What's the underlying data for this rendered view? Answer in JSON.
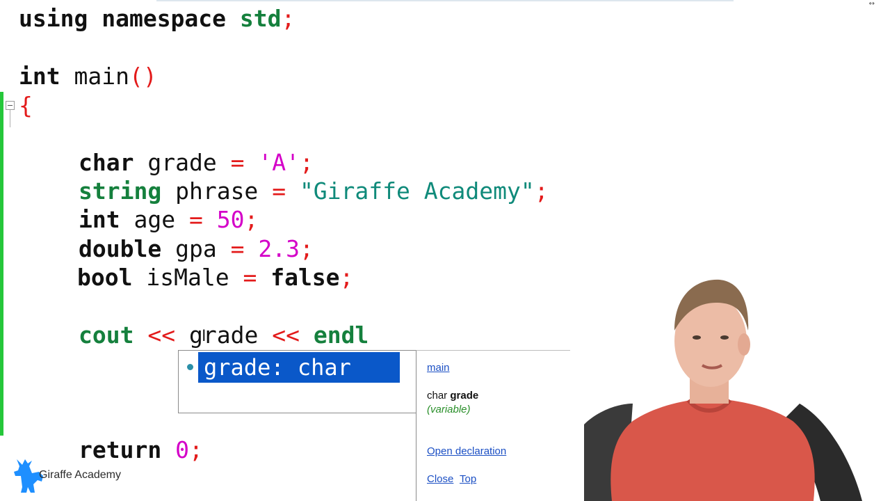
{
  "code": {
    "line_using": {
      "kw1": "using",
      "kw2": "namespace",
      "id": "std",
      "pn": ";"
    },
    "line_main": {
      "kw": "int",
      "id": "main",
      "pn": "()"
    },
    "line_open": {
      "pn": "{"
    },
    "line_char": {
      "kw": "char",
      "id": "grade",
      "op": "=",
      "val": "'A'",
      "pn": ";"
    },
    "line_string": {
      "kw": "string",
      "id": "phrase",
      "op": "=",
      "val": "\"Giraffe Academy\"",
      "pn": ";"
    },
    "line_int": {
      "kw": "int",
      "id": "age",
      "op": "=",
      "val": "50",
      "pn": ";"
    },
    "line_double": {
      "kw": "double",
      "id": "gpa",
      "op": "=",
      "val": "2.3",
      "pn": ";"
    },
    "line_bool": {
      "kw": "bool",
      "id": "isMale",
      "op": "=",
      "val": "false",
      "pn": ";"
    },
    "line_cout": {
      "kw": "cout",
      "op1": "<<",
      "id": "grade",
      "op2": "<<",
      "kw2": "endl"
    },
    "line_return": {
      "kw": "return",
      "val": "0",
      "pn": ";"
    }
  },
  "autocomplete": {
    "selected_item": "grade: char"
  },
  "info_panel": {
    "scope_link": "main",
    "type_prefix": "char",
    "name": "grade",
    "kind": "(variable)",
    "open_declaration": "Open declaration",
    "close": "Close",
    "top": "Top"
  },
  "brand": {
    "logo_text": "Giraffe Academy"
  },
  "colors": {
    "selection": "#0a58c9",
    "change_marker": "#25c73a",
    "link": "#1b4fc4",
    "keyword_green": "#15803d",
    "string_teal": "#0f8a7a",
    "literal_magenta": "#d400c8",
    "operator_red": "#e31b1b"
  },
  "icons": {
    "fold": "collapse-minus-icon",
    "logo": "giraffe-logo-icon",
    "cursor": "text-ibeam-cursor-icon",
    "resize": "horizontal-resize-icon"
  }
}
